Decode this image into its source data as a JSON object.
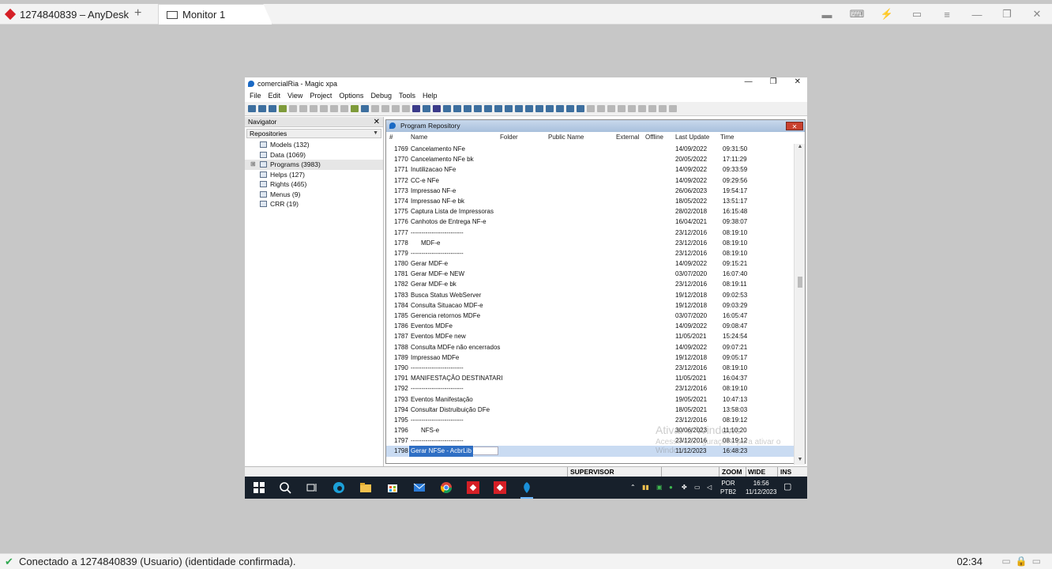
{
  "anydesk": {
    "session_tab": "1274840839 – AnyDesk",
    "new_tab": "+",
    "monitor_tab": "Monitor 1",
    "status": "Conectado a 1274840839 (Usuario) (identidade confirmada).",
    "clock": "02:34"
  },
  "magic": {
    "window_title": "comercialRia - Magic xpa",
    "menu": [
      "File",
      "Edit",
      "View",
      "Project",
      "Options",
      "Debug",
      "Tools",
      "Help"
    ]
  },
  "navigator": {
    "title": "Navigator",
    "selector": "Repositories",
    "items": [
      {
        "label": "Models",
        "count": "(132)"
      },
      {
        "label": "Data",
        "count": "(1069)"
      },
      {
        "label": "Programs",
        "count": "(3983)"
      },
      {
        "label": "Helps",
        "count": "(127)"
      },
      {
        "label": "Rights",
        "count": "(465)"
      },
      {
        "label": "Menus",
        "count": "(9)"
      },
      {
        "label": "CRR",
        "count": "(19)"
      }
    ]
  },
  "repository": {
    "title": "Program Repository",
    "columns": {
      "num": "#",
      "name": "Name",
      "folder": "Folder",
      "public_name": "Public Name",
      "external": "External",
      "offline": "Offline",
      "last_update": "Last Update",
      "time": "Time"
    },
    "rows": [
      {
        "num": "1769",
        "name": "Cancelamento NFe",
        "date": "14/09/2022",
        "time": "09:31:50"
      },
      {
        "num": "1770",
        "name": "Cancelamento NFe bk",
        "date": "20/05/2022",
        "time": "17:11:29"
      },
      {
        "num": "1771",
        "name": "Inutilizacao NFe",
        "date": "14/09/2022",
        "time": "09:33:59"
      },
      {
        "num": "1772",
        "name": "CC-e NFe",
        "date": "14/09/2022",
        "time": "09:29:56"
      },
      {
        "num": "1773",
        "name": "Impressao NF-e",
        "date": "26/06/2023",
        "time": "19:54:17"
      },
      {
        "num": "1774",
        "name": "Impressao NF-e bk",
        "date": "18/05/2022",
        "time": "13:51:17"
      },
      {
        "num": "1775",
        "name": "Captura Lista de Impressoras",
        "date": "28/02/2018",
        "time": "16:15:48"
      },
      {
        "num": "1776",
        "name": "Canhotos de Entrega NF-e",
        "date": "16/04/2021",
        "time": "09:38:07"
      },
      {
        "num": "1777",
        "name": "-------------------------",
        "date": "23/12/2016",
        "time": "08:19:10"
      },
      {
        "num": "1778",
        "name": "MDF-e",
        "indent": true,
        "date": "23/12/2016",
        "time": "08:19:10"
      },
      {
        "num": "1779",
        "name": "-------------------------",
        "date": "23/12/2016",
        "time": "08:19:10"
      },
      {
        "num": "1780",
        "name": "Gerar MDF-e",
        "date": "14/09/2022",
        "time": "09:15:21"
      },
      {
        "num": "1781",
        "name": "Gerar MDF-e NEW",
        "date": "03/07/2020",
        "time": "16:07:40"
      },
      {
        "num": "1782",
        "name": "Gerar MDF-e bk",
        "date": "23/12/2016",
        "time": "08:19:11"
      },
      {
        "num": "1783",
        "name": "Busca Status WebServer",
        "date": "19/12/2018",
        "time": "09:02:53"
      },
      {
        "num": "1784",
        "name": "Consulta Situacao MDF-e",
        "date": "19/12/2018",
        "time": "09:03:29"
      },
      {
        "num": "1785",
        "name": "Gerencia retornos MDFe",
        "date": "03/07/2020",
        "time": "16:05:47"
      },
      {
        "num": "1786",
        "name": "Eventos MDFe",
        "date": "14/09/2022",
        "time": "09:08:47"
      },
      {
        "num": "1787",
        "name": "Eventos MDFe new",
        "date": "11/05/2021",
        "time": "15:24:54"
      },
      {
        "num": "1788",
        "name": "Consulta MDFe não encerrados",
        "date": "14/09/2022",
        "time": "09:07:21"
      },
      {
        "num": "1789",
        "name": "Impressao MDFe",
        "date": "19/12/2018",
        "time": "09:05:17"
      },
      {
        "num": "1790",
        "name": "-------------------------",
        "date": "23/12/2016",
        "time": "08:19:10"
      },
      {
        "num": "1791",
        "name": "MANIFESTAÇÃO DESTINATARI",
        "date": "11/05/2021",
        "time": "16:04:37"
      },
      {
        "num": "1792",
        "name": "-------------------------",
        "date": "23/12/2016",
        "time": "08:19:10"
      },
      {
        "num": "1793",
        "name": "Eventos Manifestação",
        "date": "19/05/2021",
        "time": "10:47:13"
      },
      {
        "num": "1794",
        "name": "Consultar Distruibuição DFe",
        "date": "18/05/2021",
        "time": "13:58:03"
      },
      {
        "num": "1795",
        "name": "-------------------------",
        "date": "23/12/2016",
        "time": "08:19:12"
      },
      {
        "num": "1796",
        "name": "NFS-e",
        "indent": true,
        "date": "30/06/2023",
        "time": "11:10:20"
      },
      {
        "num": "1797",
        "name": "-------------------------",
        "date": "23/12/2016",
        "time": "08:19:12"
      },
      {
        "num": "1798",
        "name": "Gerar NFSe - AcbrLib",
        "date": "11/12/2023",
        "time": "16:48:23",
        "selected": true
      }
    ]
  },
  "watermark": {
    "line1": "Ativar o Windows",
    "line2": "Acesse Configurações para ativar o Windows."
  },
  "statusbar": {
    "mode": "SUPERVISOR",
    "zoom": "ZOOM",
    "wide": "WIDE",
    "ins": "INS"
  },
  "tray": {
    "lang1": "POR",
    "lang2": "PTB2",
    "time": "16:56",
    "date": "11/12/2023"
  }
}
